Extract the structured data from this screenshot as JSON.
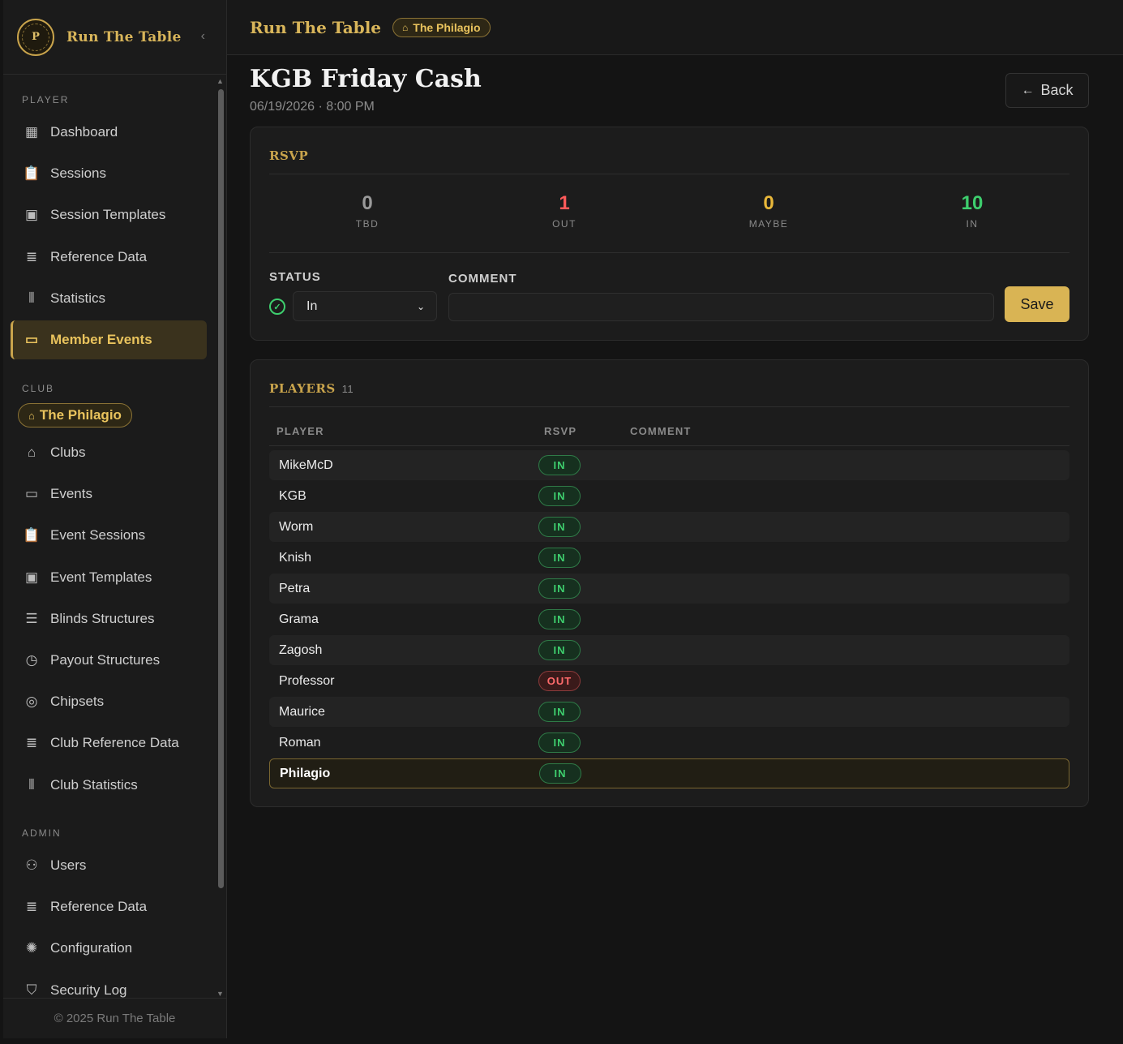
{
  "app": {
    "name": "Run The Table",
    "logo_letter": "P",
    "footer": "© 2025 Run The Table"
  },
  "sidebar": {
    "collapse_icon": "chevron-left-icon",
    "sections": {
      "player": "PLAYER",
      "club": "CLUB",
      "admin": "ADMIN"
    },
    "player_items": [
      {
        "label": "Dashboard",
        "icon": "grid-icon"
      },
      {
        "label": "Sessions",
        "icon": "clipboard-icon"
      },
      {
        "label": "Session Templates",
        "icon": "layout-icon"
      },
      {
        "label": "Reference Data",
        "icon": "list-icon"
      },
      {
        "label": "Statistics",
        "icon": "bar-chart-icon"
      },
      {
        "label": "Member Events",
        "icon": "calendar-icon",
        "active": true
      }
    ],
    "club_pill": "The Philagio",
    "club_items": [
      {
        "label": "Clubs",
        "icon": "home-icon"
      },
      {
        "label": "Events",
        "icon": "calendar-icon"
      },
      {
        "label": "Event Sessions",
        "icon": "clipboard-icon"
      },
      {
        "label": "Event Templates",
        "icon": "layout-icon"
      },
      {
        "label": "Blinds Structures",
        "icon": "menu-icon"
      },
      {
        "label": "Payout Structures",
        "icon": "clock-icon"
      },
      {
        "label": "Chipsets",
        "icon": "chip-icon"
      },
      {
        "label": "Club Reference Data",
        "icon": "list-icon"
      },
      {
        "label": "Club Statistics",
        "icon": "bar-chart-icon"
      }
    ],
    "admin_items": [
      {
        "label": "Users",
        "icon": "users-icon"
      },
      {
        "label": "Reference Data",
        "icon": "list-icon"
      },
      {
        "label": "Configuration",
        "icon": "sun-gear-icon"
      },
      {
        "label": "Security Log",
        "icon": "shield-icon"
      }
    ]
  },
  "topbar": {
    "title": "Run The Table",
    "club": "The Philagio"
  },
  "event": {
    "title": "KGB Friday Cash",
    "subtitle": "06/19/2026 · 8:00 PM",
    "back_label": "Back"
  },
  "rsvp": {
    "title": "RSVP",
    "stats": [
      {
        "value": "0",
        "label": "TBD",
        "color": "#9a9a9a"
      },
      {
        "value": "1",
        "label": "OUT",
        "color": "#ff5a5a"
      },
      {
        "value": "0",
        "label": "MAYBE",
        "color": "#e9b83a"
      },
      {
        "value": "10",
        "label": "IN",
        "color": "#3ecf6e"
      }
    ],
    "status_label": "STATUS",
    "status_value": "In",
    "comment_label": "COMMENT",
    "comment_value": "",
    "save_label": "Save"
  },
  "players": {
    "title": "PLAYERS",
    "count": "11",
    "columns": [
      "PLAYER",
      "RSVP",
      "COMMENT"
    ],
    "rows": [
      {
        "name": "MikeMcD",
        "rsvp": "IN",
        "comment": ""
      },
      {
        "name": "KGB",
        "rsvp": "IN",
        "comment": ""
      },
      {
        "name": "Worm",
        "rsvp": "IN",
        "comment": ""
      },
      {
        "name": "Knish",
        "rsvp": "IN",
        "comment": ""
      },
      {
        "name": "Petra",
        "rsvp": "IN",
        "comment": ""
      },
      {
        "name": "Grama",
        "rsvp": "IN",
        "comment": ""
      },
      {
        "name": "Zagosh",
        "rsvp": "IN",
        "comment": ""
      },
      {
        "name": "Professor",
        "rsvp": "OUT",
        "comment": ""
      },
      {
        "name": "Maurice",
        "rsvp": "IN",
        "comment": ""
      },
      {
        "name": "Roman",
        "rsvp": "IN",
        "comment": ""
      },
      {
        "name": "Philagio",
        "rsvp": "IN",
        "comment": "",
        "current_user": true
      }
    ]
  }
}
